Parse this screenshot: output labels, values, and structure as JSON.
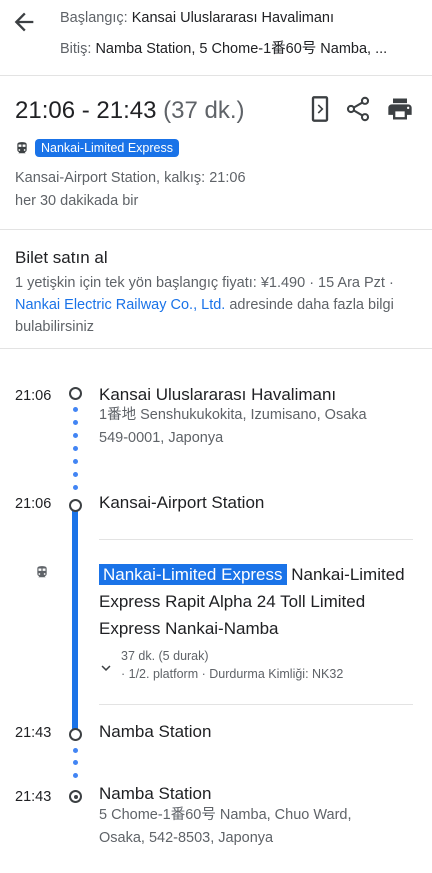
{
  "header": {
    "from_label": "Başlangıç:",
    "from_value": "Kansai Uluslararası Havalimanı",
    "to_label": "Bitiş:",
    "to_value": "Namba Station, 5 Chome-1番60号 Namba, ...",
    "back_icon": "arrow-back-icon"
  },
  "summary": {
    "time_range": "21:06 - 21:43",
    "duration": "(37 dk.)",
    "actions": [
      "open-in-app-icon",
      "share-icon",
      "print-icon"
    ],
    "mode_icon": "train-icon",
    "line_name": "Nankai-Limited Express",
    "departure_text": "Kansai-Airport Station, kalkış: 21:06",
    "frequency_text": "her 30 dakikada bir"
  },
  "ticket": {
    "title": "Bilet satın al",
    "body_prefix": "1 yetişkin için tek yön başlangıç fiyatı: ¥1.490 · 15 Ara Pzt · ",
    "link": "Nankai Electric Railway Co., Ltd.",
    "body_suffix": " adresinde daha fazla bilgi bulabilirsiniz"
  },
  "timeline": {
    "start": {
      "time": "21:06",
      "name": "Kansai Uluslararası Havalimanı",
      "address_line1": "1番地 Senshukukokita, Izumisano, Osaka",
      "address_line2": "549-0001, Japonya"
    },
    "board": {
      "time": "21:06",
      "name": "Kansai-Airport Station"
    },
    "transit": {
      "mode_icon": "train-icon",
      "line_chip": "Nankai-Limited Express",
      "line_desc": "Nankai-Limited Express Rapit Alpha 24 Toll Limited Express Nankai-Namba",
      "stops_summary": "37 dk. (5 durak)",
      "platform_info": "· 1/2. platform · Durdurma Kimliği: NK32"
    },
    "alight": {
      "time": "21:43",
      "name": "Namba Station"
    },
    "end": {
      "time": "21:43",
      "name": "Namba Station",
      "address_line1": "5 Chome-1番60号 Namba, Chuo Ward,",
      "address_line2": "Osaka, 542-8503, Japonya"
    }
  },
  "colors": {
    "accent": "#1a73e8",
    "dots": "#4285f4",
    "text": "#202124",
    "muted": "#5f6368"
  }
}
